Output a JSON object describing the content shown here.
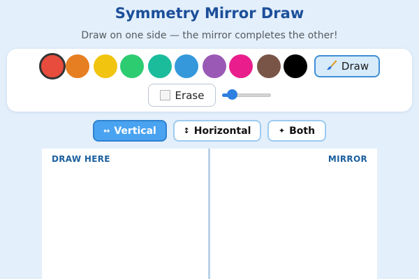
{
  "header": {
    "title": "Symmetry Mirror Draw",
    "subtitle": "Draw on one side — the mirror completes the other!"
  },
  "palette": {
    "selected_color": "#e74c3c",
    "colors": [
      "#e74c3c",
      "#e67e22",
      "#f1c40f",
      "#2ecc71",
      "#1abc9c",
      "#3498db",
      "#9b59b6",
      "#e91e8c",
      "#795548",
      "#000000"
    ]
  },
  "tools": {
    "draw_icon": "paintbrush-icon",
    "draw_label": "Draw",
    "erase_icon": "eraser-square-icon",
    "erase_label": "Erase"
  },
  "brush_size": {
    "value_fraction": 0.2
  },
  "modes": [
    {
      "icon": "↔",
      "label": "Vertical",
      "active": true
    },
    {
      "icon": "↕",
      "label": "Horizontal",
      "active": false
    },
    {
      "icon": "✦",
      "label": "Both",
      "active": false
    }
  ],
  "canvas": {
    "left_label": "DRAW HERE",
    "right_label": "MIRROR"
  },
  "colors": {
    "accent": "#4aa3f0",
    "title": "#1c4f9a",
    "background": "#e3effb"
  }
}
